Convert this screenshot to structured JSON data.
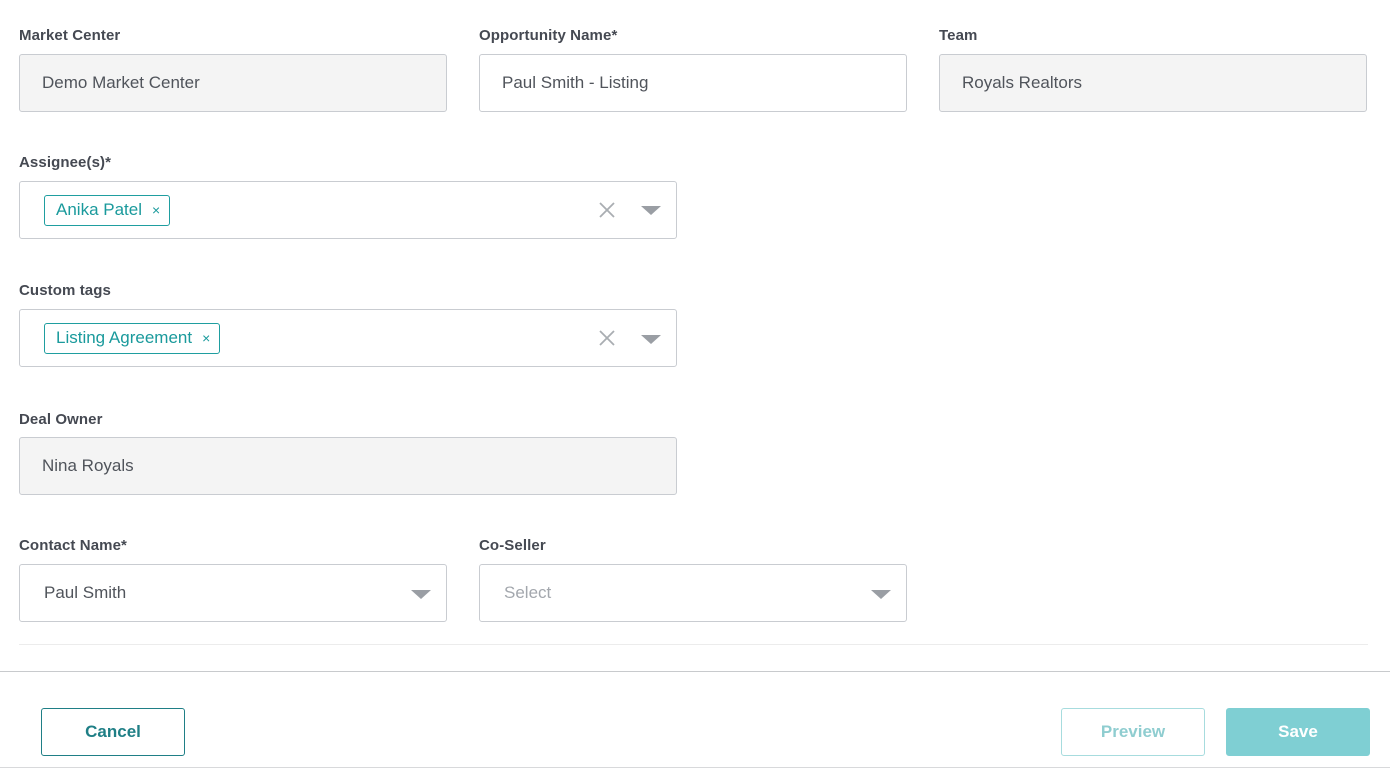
{
  "market_center": {
    "label": "Market Center",
    "value": "Demo Market Center"
  },
  "opportunity_name": {
    "label": "Opportunity Name*",
    "value": "Paul Smith - Listing"
  },
  "team": {
    "label": "Team",
    "value": "Royals Realtors"
  },
  "assignees": {
    "label": "Assignee(s)*",
    "chips": [
      "Anika Patel"
    ]
  },
  "custom_tags": {
    "label": "Custom tags",
    "chips": [
      "Listing Agreement"
    ]
  },
  "deal_owner": {
    "label": "Deal Owner",
    "value": "Nina Royals"
  },
  "contact_name": {
    "label": "Contact Name*",
    "value": "Paul Smith"
  },
  "co_seller": {
    "label": "Co-Seller",
    "placeholder": "Select"
  },
  "footer": {
    "cancel_label": "Cancel",
    "preview_label": "Preview",
    "save_label": "Save"
  },
  "icons": {
    "chip_remove": "×",
    "clear": "close-icon",
    "dropdown": "caret-down-icon"
  },
  "colors": {
    "accent": "#1a9a9c",
    "save_bg": "#7fcfd3",
    "readonly_bg": "#f4f4f4"
  }
}
